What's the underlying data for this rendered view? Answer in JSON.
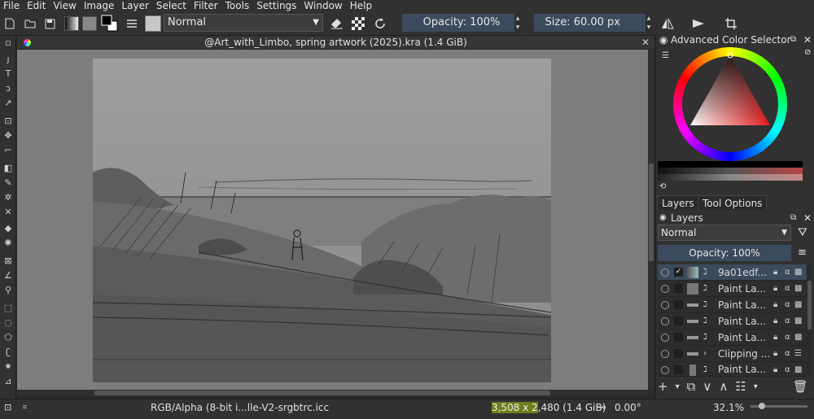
{
  "menu": [
    "File",
    "Edit",
    "View",
    "Image",
    "Layer",
    "Select",
    "Filter",
    "Tools",
    "Settings",
    "Window",
    "Help"
  ],
  "toolbar": {
    "blend_mode": "Normal",
    "opacity": "Opacity: 100%",
    "size": "Size: 60.00 px"
  },
  "document": {
    "title": "@Art_with_Limbo, spring artwork (2025).kra (1.4 GiB)"
  },
  "color_selector": {
    "title": "Advanced Color Selector"
  },
  "dock_tabs": [
    "Layers",
    "Tool Options"
  ],
  "layers": {
    "title": "Layers",
    "blend_mode": "Normal",
    "opacity": "Opacity:  100%",
    "items": [
      {
        "name": "9a01edf...",
        "selected": true,
        "checked": "✓"
      },
      {
        "name": "Paint La...",
        "selected": false,
        "checked": ""
      },
      {
        "name": "Paint La...",
        "selected": false,
        "checked": ""
      },
      {
        "name": "Paint La...",
        "selected": false,
        "checked": ""
      },
      {
        "name": "Paint La...",
        "selected": false,
        "checked": ""
      },
      {
        "name": "Clipping ...",
        "selected": false,
        "checked": ""
      },
      {
        "name": "Paint La...",
        "selected": false,
        "checked": ""
      }
    ]
  },
  "status": {
    "color_profile": "RGB/Alpha (8-bit i...lle-V2-srgbtrc.icc",
    "size_highlight": "3,508 x 2",
    "size_rest": ",480 (1.4 GiB)",
    "rotation": "0.00°",
    "zoom": "32.1%"
  }
}
